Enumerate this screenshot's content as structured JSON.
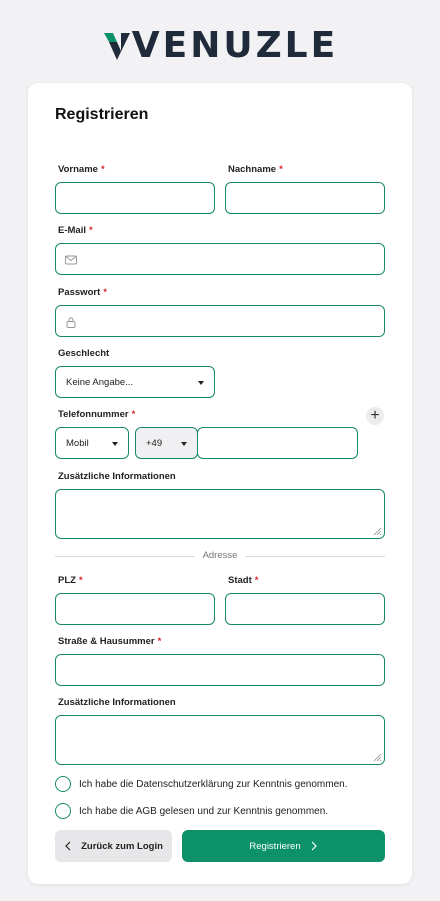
{
  "brand": {
    "logo_text": "VENUZLE",
    "accent_color": "#0d9168",
    "dark_color": "#1f2a3a"
  },
  "form": {
    "title": "Registrieren",
    "required_mark": "*",
    "fields": {
      "vorname": {
        "label": "Vorname",
        "value": "",
        "required": true
      },
      "nachname": {
        "label": "Nachname",
        "value": "",
        "required": true
      },
      "email": {
        "label": "E-Mail",
        "value": "",
        "required": true,
        "icon": "envelope-icon"
      },
      "passwort": {
        "label": "Passwort",
        "value": "",
        "required": true,
        "icon": "lock-icon"
      },
      "geschlecht": {
        "label": "Geschlecht",
        "selected": "Keine Angabe..."
      },
      "telefon": {
        "label": "Telefonnummer",
        "required": true,
        "type_selected": "Mobil",
        "prefix_selected": "+49",
        "value": ""
      },
      "zusatz1": {
        "label": "Zusätzliche Informationen",
        "value": ""
      },
      "plz": {
        "label": "PLZ",
        "value": "",
        "required": true
      },
      "stadt": {
        "label": "Stadt",
        "value": "",
        "required": true
      },
      "strasse": {
        "label": "Straße & Hausummer",
        "value": "",
        "required": true
      },
      "zusatz2": {
        "label": "Zusätzliche Informationen",
        "value": ""
      }
    },
    "address_divider": "Adresse",
    "checkboxes": {
      "privacy": "Ich habe die Datenschutzerklärung zur Kenntnis genommen.",
      "agb": "Ich habe die AGB gelesen und zur Kenntnis genommen."
    },
    "buttons": {
      "back": "Zurück zum Login",
      "register": "Registrieren"
    }
  }
}
